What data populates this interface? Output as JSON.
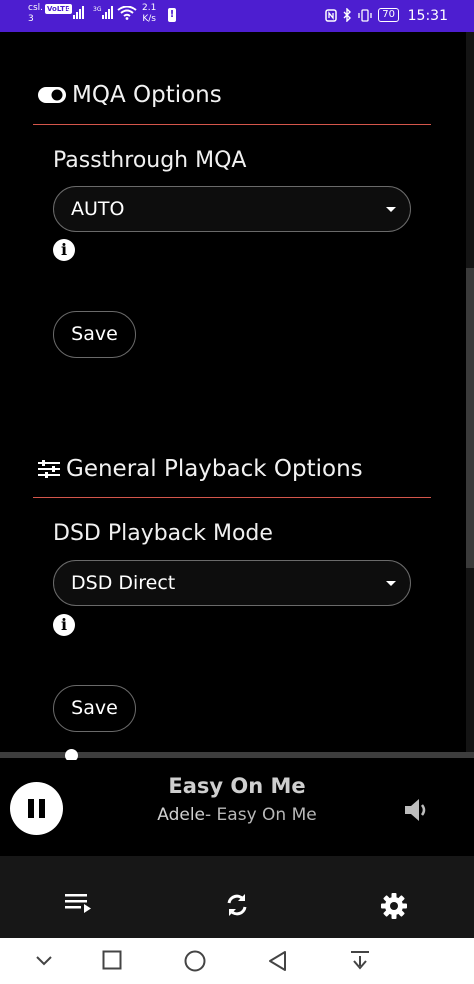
{
  "status_bar": {
    "carrier": "csl.",
    "carrier_sub": "3",
    "volte": "VoLTE",
    "net1": "4G",
    "net2": "3G",
    "speed_value": "2.1",
    "speed_unit": "K/s",
    "battery": "70",
    "time": "15:31"
  },
  "mqa_section": {
    "title": "MQA Options",
    "icon": "toggle-icon",
    "field_label": "Passthrough MQA",
    "selected": "AUTO",
    "save_label": "Save"
  },
  "playback_section": {
    "title": "General Playback Options",
    "icon": "sliders-icon",
    "field_label": "DSD Playback Mode",
    "selected": "DSD Direct",
    "save_label": "Save"
  },
  "player": {
    "track_title": "Easy On Me",
    "artist": "Adele",
    "album": "- Easy On Me",
    "progress": 0.15
  },
  "toolbar": {
    "items": [
      "queue-icon",
      "sync-icon",
      "settings-icon"
    ]
  },
  "nav_bar": {
    "items": [
      "chevron-down-icon",
      "recents-icon",
      "home-icon",
      "back-icon",
      "download-icon"
    ]
  },
  "colors": {
    "status_bar": "#4d1ed0",
    "divider": "#d4564b",
    "background": "#000000"
  }
}
